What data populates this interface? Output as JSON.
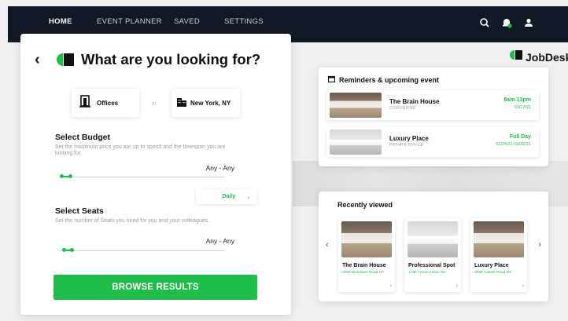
{
  "nav": {
    "items": [
      "HOME",
      "EVENT PLANNER",
      "SAVED",
      "SETTINGS"
    ],
    "active": "HOME",
    "icons": [
      "search-icon",
      "notification-bell-icon",
      "user-icon"
    ]
  },
  "search_panel": {
    "title": "What are you looking for?",
    "category": {
      "label": "Offices",
      "icon": "door-icon"
    },
    "connector": "in",
    "location": {
      "label": "New York, NY",
      "icon": "city-buildings-icon"
    },
    "budget": {
      "title": "Select Budget",
      "description": "Set the maximum price you are up to spend and the timespan you are looking for.",
      "range_value": "Any - Any",
      "period": "Daily"
    },
    "seats": {
      "title": "Select Seats",
      "description": "Set the number of Seats you need for you and your colleagues.",
      "range_value": "Any - Any"
    },
    "browse_button": "BROWSE RESULTS"
  },
  "logo": {
    "text": "JobDesk"
  },
  "reminders": {
    "title": "Reminders & upcoming event",
    "events": [
      {
        "name": "The Brain House",
        "type": "COWORKING",
        "time": "8am-13pm",
        "date": "01/17/21"
      },
      {
        "name": "Luxury Place",
        "type": "PRIVATE OFFICE",
        "time": "Full Day",
        "date": "01/24/21-01/26/21"
      }
    ]
  },
  "recently_viewed": {
    "title": "Recently viewed",
    "items": [
      {
        "name": "The Brain House",
        "address": "3059 Bickdown Road NY"
      },
      {
        "name": "Professional Spot",
        "address": "1795 Fenaoi Drive NC"
      },
      {
        "name": "Luxury Place",
        "address": "3059 Coless Road NY"
      }
    ]
  },
  "colors": {
    "accent": "#1fbe4a",
    "nav_bg": "#111826",
    "page_bg": "#eef0f2"
  }
}
